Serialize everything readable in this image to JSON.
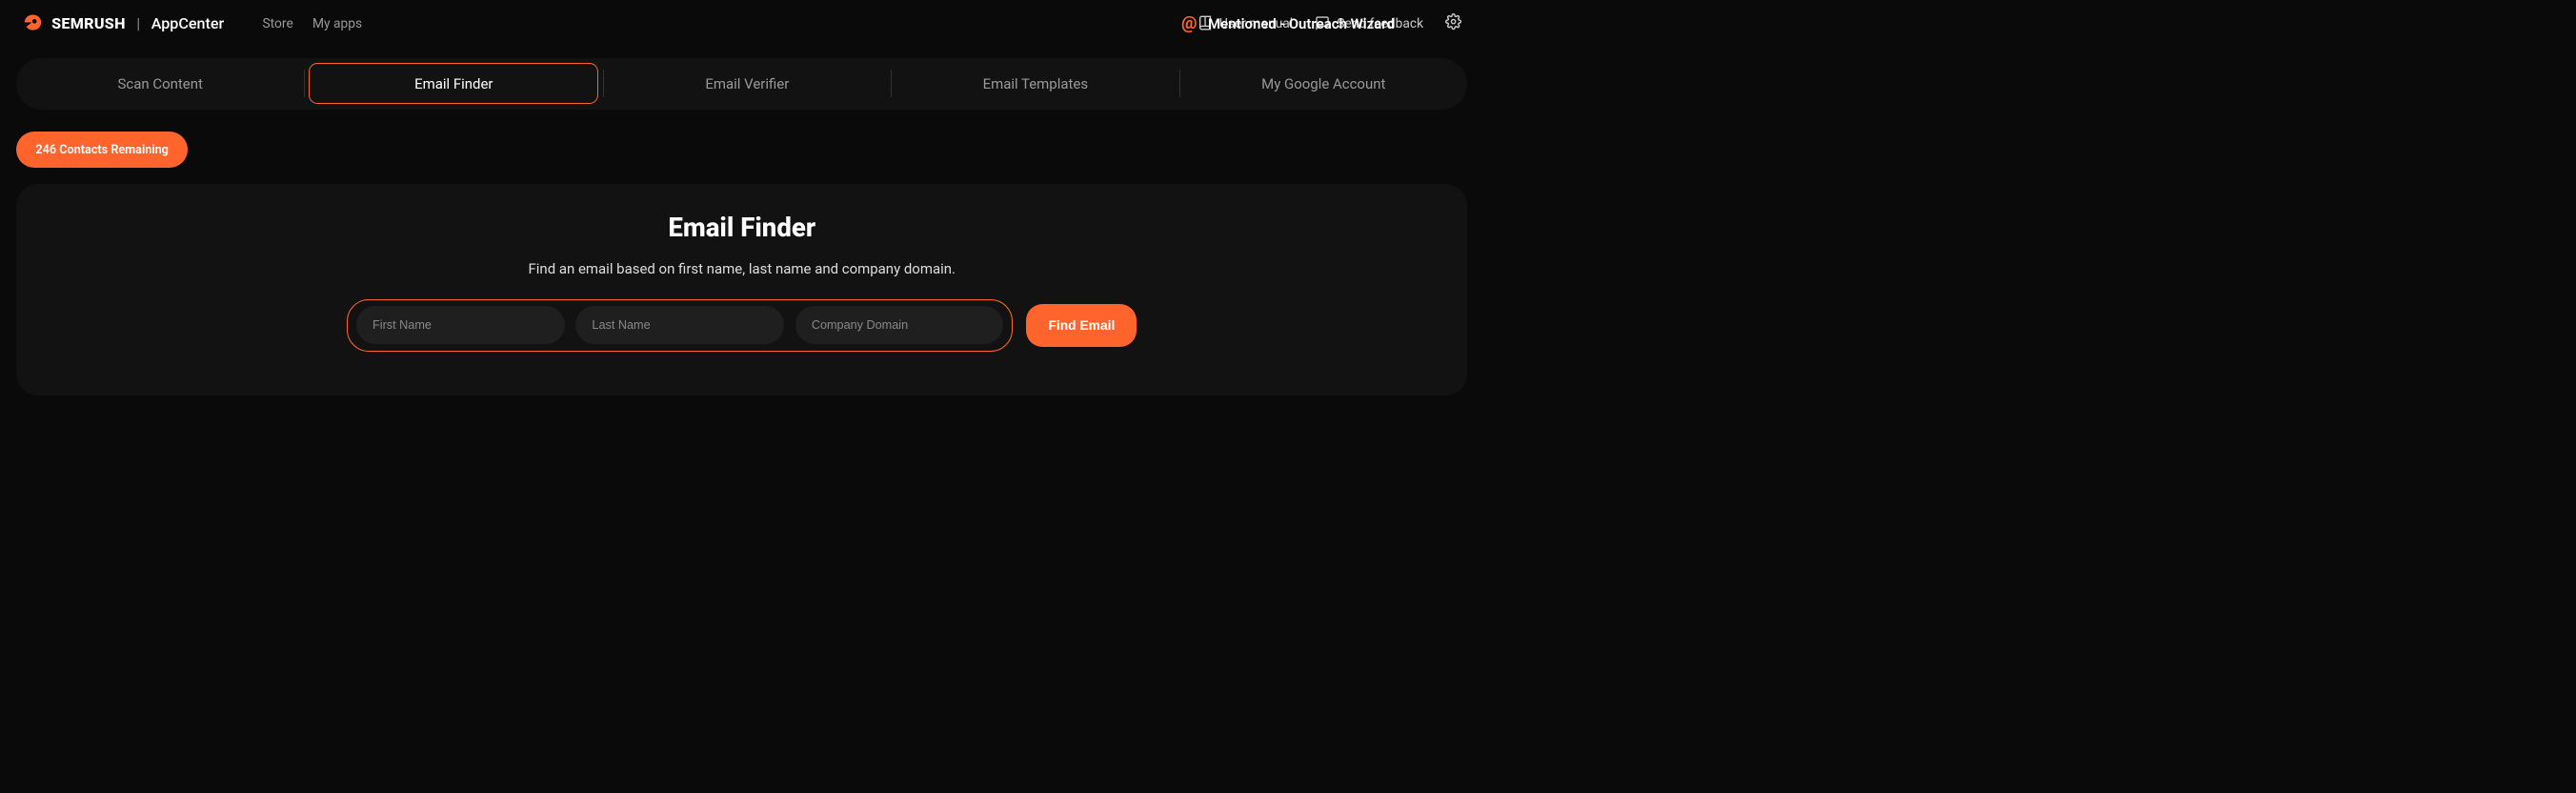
{
  "header": {
    "brand": "SEMRUSH",
    "app_center": "AppCenter",
    "nav": {
      "store": "Store",
      "my_apps": "My apps"
    },
    "app_title": "Mentioned - Outreach Wizard",
    "actions": {
      "user_manual": "User manual",
      "send_feedback": "Send feedback"
    }
  },
  "tabs": {
    "scan_content": "Scan Content",
    "email_finder": "Email Finder",
    "email_verifier": "Email Verifier",
    "email_templates": "Email Templates",
    "google_account": "My Google Account"
  },
  "contacts_badge": "246 Contacts Remaining",
  "main": {
    "heading": "Email Finder",
    "subtitle": "Find an email based on first name, last name and company domain.",
    "inputs": {
      "first_name_placeholder": "First Name",
      "last_name_placeholder": "Last Name",
      "company_domain_placeholder": "Company Domain"
    },
    "button": "Find Email"
  }
}
